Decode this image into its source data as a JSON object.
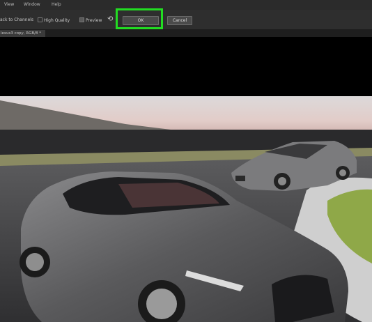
{
  "menubar": {
    "items": [
      "View",
      "Window",
      "Help"
    ]
  },
  "options": {
    "back_to_channels": "ack to Channels",
    "high_quality": "High Quality",
    "preview": "Preview",
    "ok_label": "OK",
    "cancel_label": "Cancel"
  },
  "document": {
    "tab_title": "lexus3 copy, RGB/8 *"
  },
  "colors": {
    "highlight": "#22dd22",
    "chrome": "#2e2e2e"
  }
}
